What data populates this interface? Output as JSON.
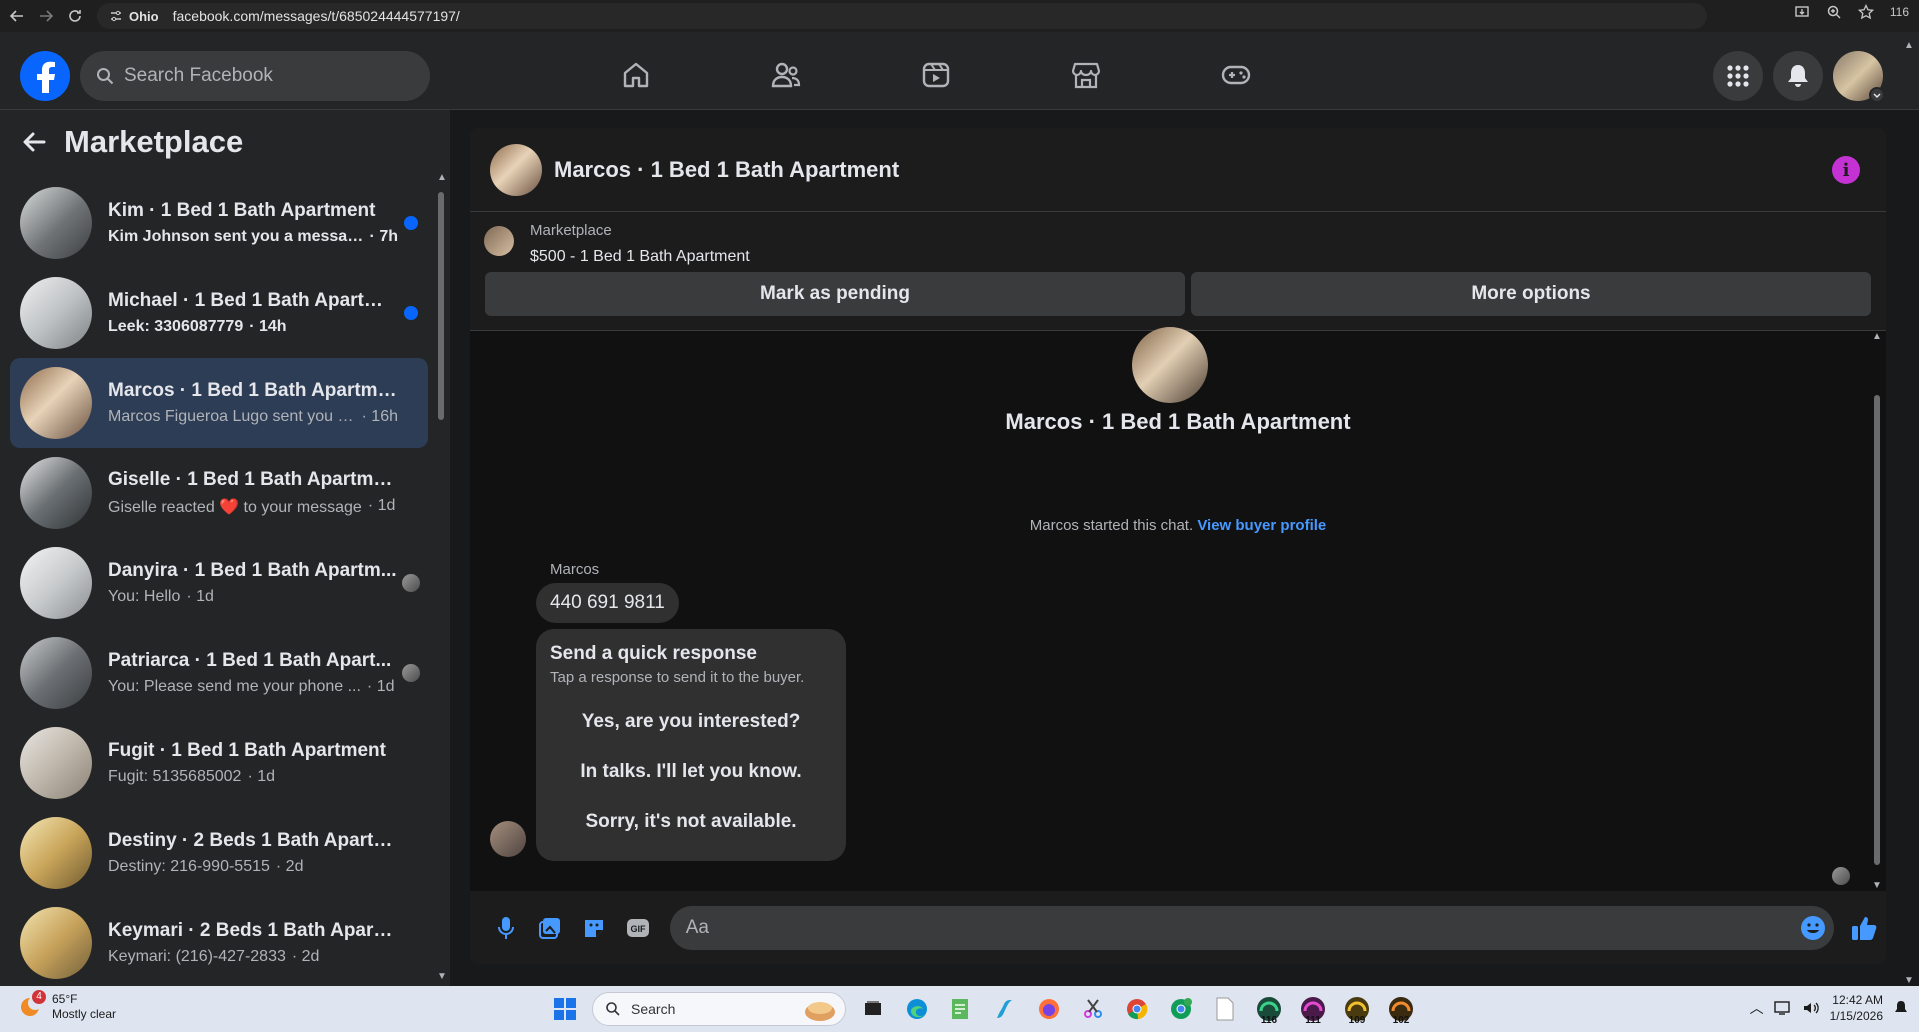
{
  "browser": {
    "site_chip": "Ohio",
    "url": "facebook.com/messages/t/685024444577197/",
    "zoom_badge": "116"
  },
  "fb": {
    "search_placeholder": "Search Facebook"
  },
  "sidebar": {
    "title": "Marketplace",
    "conversations": [
      {
        "name": "Kim · 1 Bed 1 Bath Apartment",
        "snippet": "Kim Johnson sent you a messag...",
        "time": "· 7h",
        "unread": true
      },
      {
        "name": "Michael · 1 Bed 1 Bath Apartme...",
        "snippet": "Leek: 3306087779",
        "time": "· 14h",
        "unread": true
      },
      {
        "name": "Marcos · 1 Bed 1 Bath Apartment",
        "snippet": "Marcos Figueroa Lugo sent you a ...",
        "time": "· 16h",
        "unread": false
      },
      {
        "name": "Giselle · 1 Bed 1 Bath Apartment",
        "snippet": "Giselle reacted ❤️ to your message",
        "time": "· 1d",
        "unread": false
      },
      {
        "name": "Danyira · 1 Bed 1 Bath Apartm...",
        "snippet": "You: Hello",
        "time": "· 1d",
        "unread": false
      },
      {
        "name": "Patriarca · 1 Bed 1 Bath Apart...",
        "snippet": "You: Please send me your phone ...",
        "time": "· 1d",
        "unread": false
      },
      {
        "name": "Fugit · 1 Bed 1 Bath Apartment",
        "snippet": "Fugit: 5135685002",
        "time": "· 1d",
        "unread": false
      },
      {
        "name": "Destiny · 2 Beds 1 Bath Apartment",
        "snippet": "Destiny: 216-990-5515",
        "time": "· 2d",
        "unread": false
      },
      {
        "name": "Keymari · 2 Beds 1 Bath Apartment",
        "snippet": "Keymari: (216)-427-2833",
        "time": "· 2d",
        "unread": false
      }
    ]
  },
  "chat": {
    "title": "Marcos · 1 Bed 1 Bath Apartment",
    "marketplace_label": "Marketplace",
    "listing": "$500 - 1 Bed 1 Bath Apartment",
    "mark_pending": "Mark as pending",
    "more_options": "More options",
    "thread_title": "Marcos · 1 Bed 1 Bath Apartment",
    "started_text": "Marcos started this chat.",
    "buyer_profile_link": "View buyer profile",
    "sender_name": "Marcos",
    "message_text": "440 691 9811",
    "quick_title": "Send a quick response",
    "quick_subtitle": "Tap a response to send it to the buyer.",
    "quick_options": [
      "Yes, are you interested?",
      "In talks. I'll let you know.",
      "Sorry, it's not available."
    ],
    "composer_placeholder": "Aa"
  },
  "taskbar": {
    "weather_temp": "65°F",
    "weather_desc": "Mostly clear",
    "weather_badge": "4",
    "search_label": "Search",
    "time": "12:42 AM",
    "date": "1/15/2026",
    "tray_badges": [
      "116",
      "111",
      "109",
      "102"
    ]
  }
}
